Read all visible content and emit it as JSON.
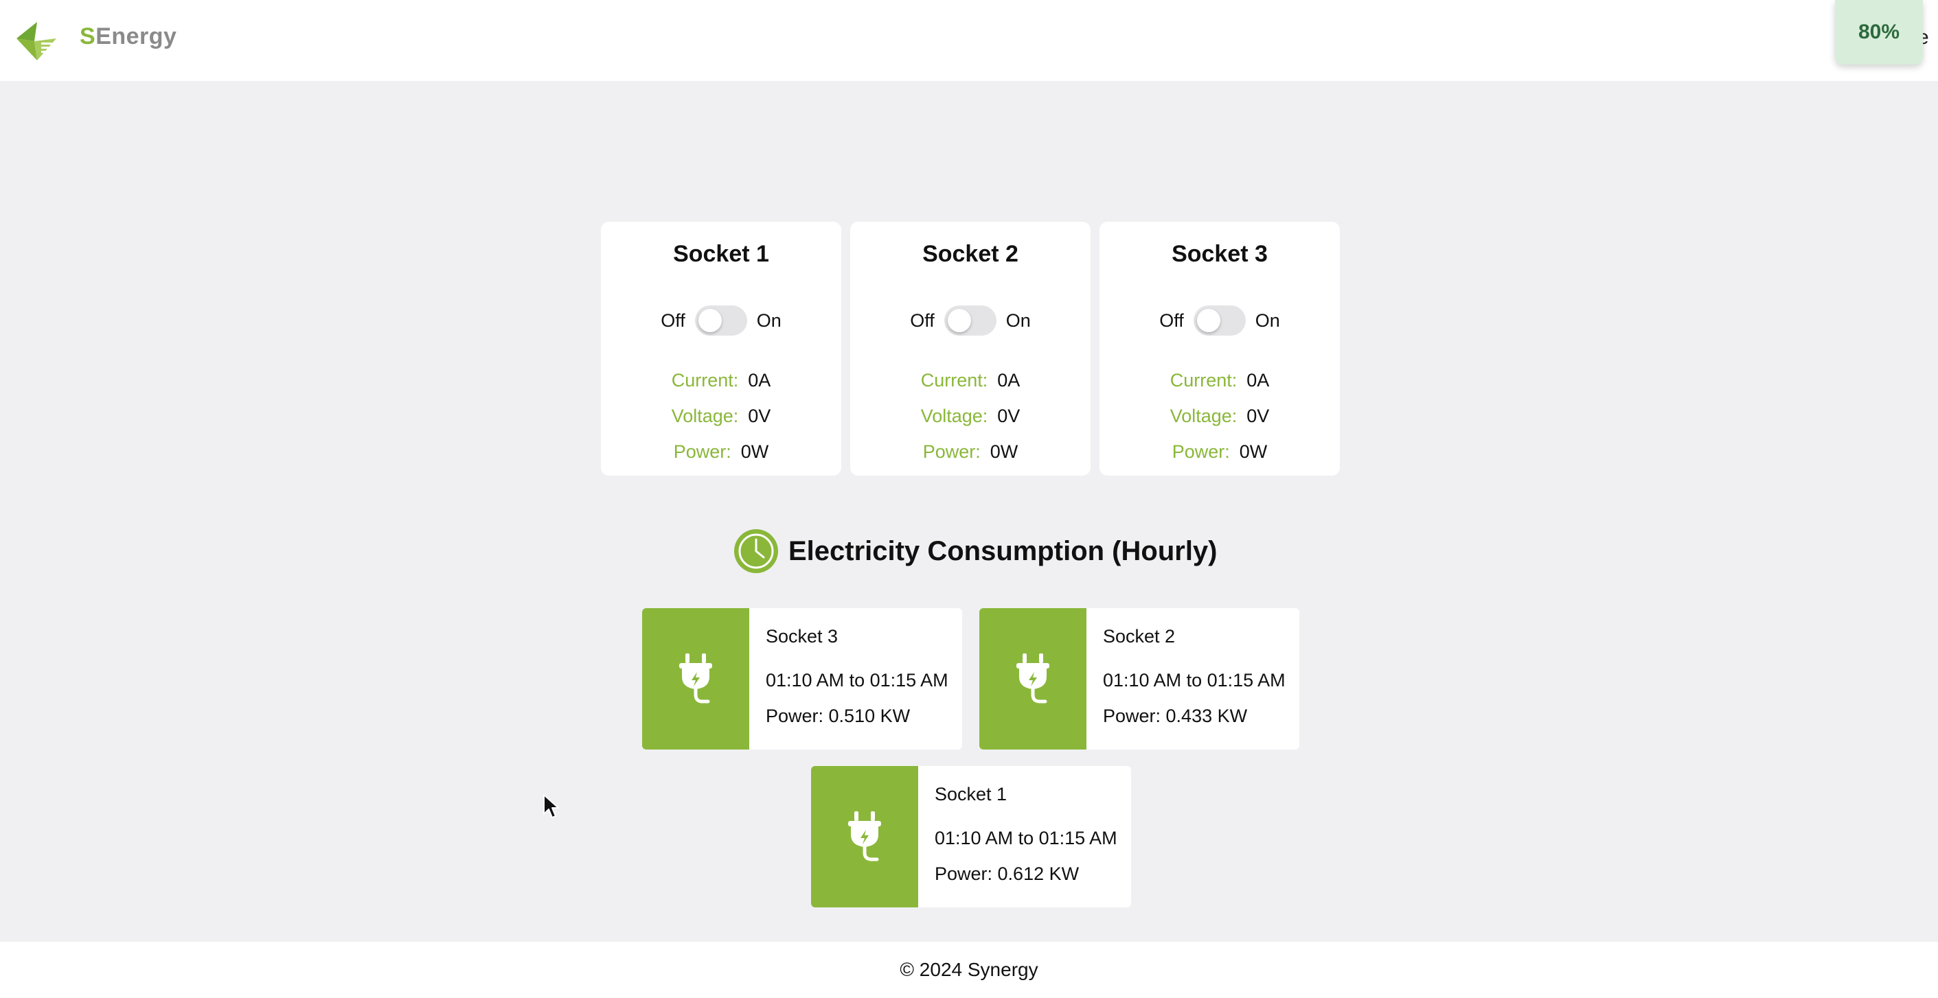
{
  "header": {
    "logo_text_prefix": "S",
    "logo_text_rest": "Energy",
    "zoom_badge": "80%",
    "edge_text": "e"
  },
  "sockets": [
    {
      "title": "Socket 1",
      "off_label": "Off",
      "on_label": "On",
      "toggle_on": false,
      "current_label": "Current:",
      "current_value": "0A",
      "voltage_label": "Voltage:",
      "voltage_value": "0V",
      "power_label": "Power:",
      "power_value": "0W"
    },
    {
      "title": "Socket 2",
      "off_label": "Off",
      "on_label": "On",
      "toggle_on": false,
      "current_label": "Current:",
      "current_value": "0A",
      "voltage_label": "Voltage:",
      "voltage_value": "0V",
      "power_label": "Power:",
      "power_value": "0W"
    },
    {
      "title": "Socket 3",
      "off_label": "Off",
      "on_label": "On",
      "toggle_on": false,
      "current_label": "Current:",
      "current_value": "0A",
      "voltage_label": "Voltage:",
      "voltage_value": "0V",
      "power_label": "Power:",
      "power_value": "0W"
    }
  ],
  "consumption": {
    "heading": "Electricity Consumption (Hourly)",
    "icon": "clock-icon",
    "entries": [
      {
        "socket": "Socket 3",
        "range": "01:10 AM to 01:15 AM",
        "power": "Power: 0.510 KW",
        "icon": "plug-icon"
      },
      {
        "socket": "Socket 2",
        "range": "01:10 AM to 01:15 AM",
        "power": "Power: 0.433 KW",
        "icon": "plug-icon"
      },
      {
        "socket": "Socket 1",
        "range": "01:10 AM to 01:15 AM",
        "power": "Power: 0.612 KW",
        "icon": "plug-icon"
      }
    ]
  },
  "footer": {
    "copyright": "© 2024 Synergy"
  },
  "colors": {
    "accent": "#8ab73a",
    "background": "#f0f0f2",
    "card": "#ffffff",
    "badge": "#d8eedb"
  }
}
